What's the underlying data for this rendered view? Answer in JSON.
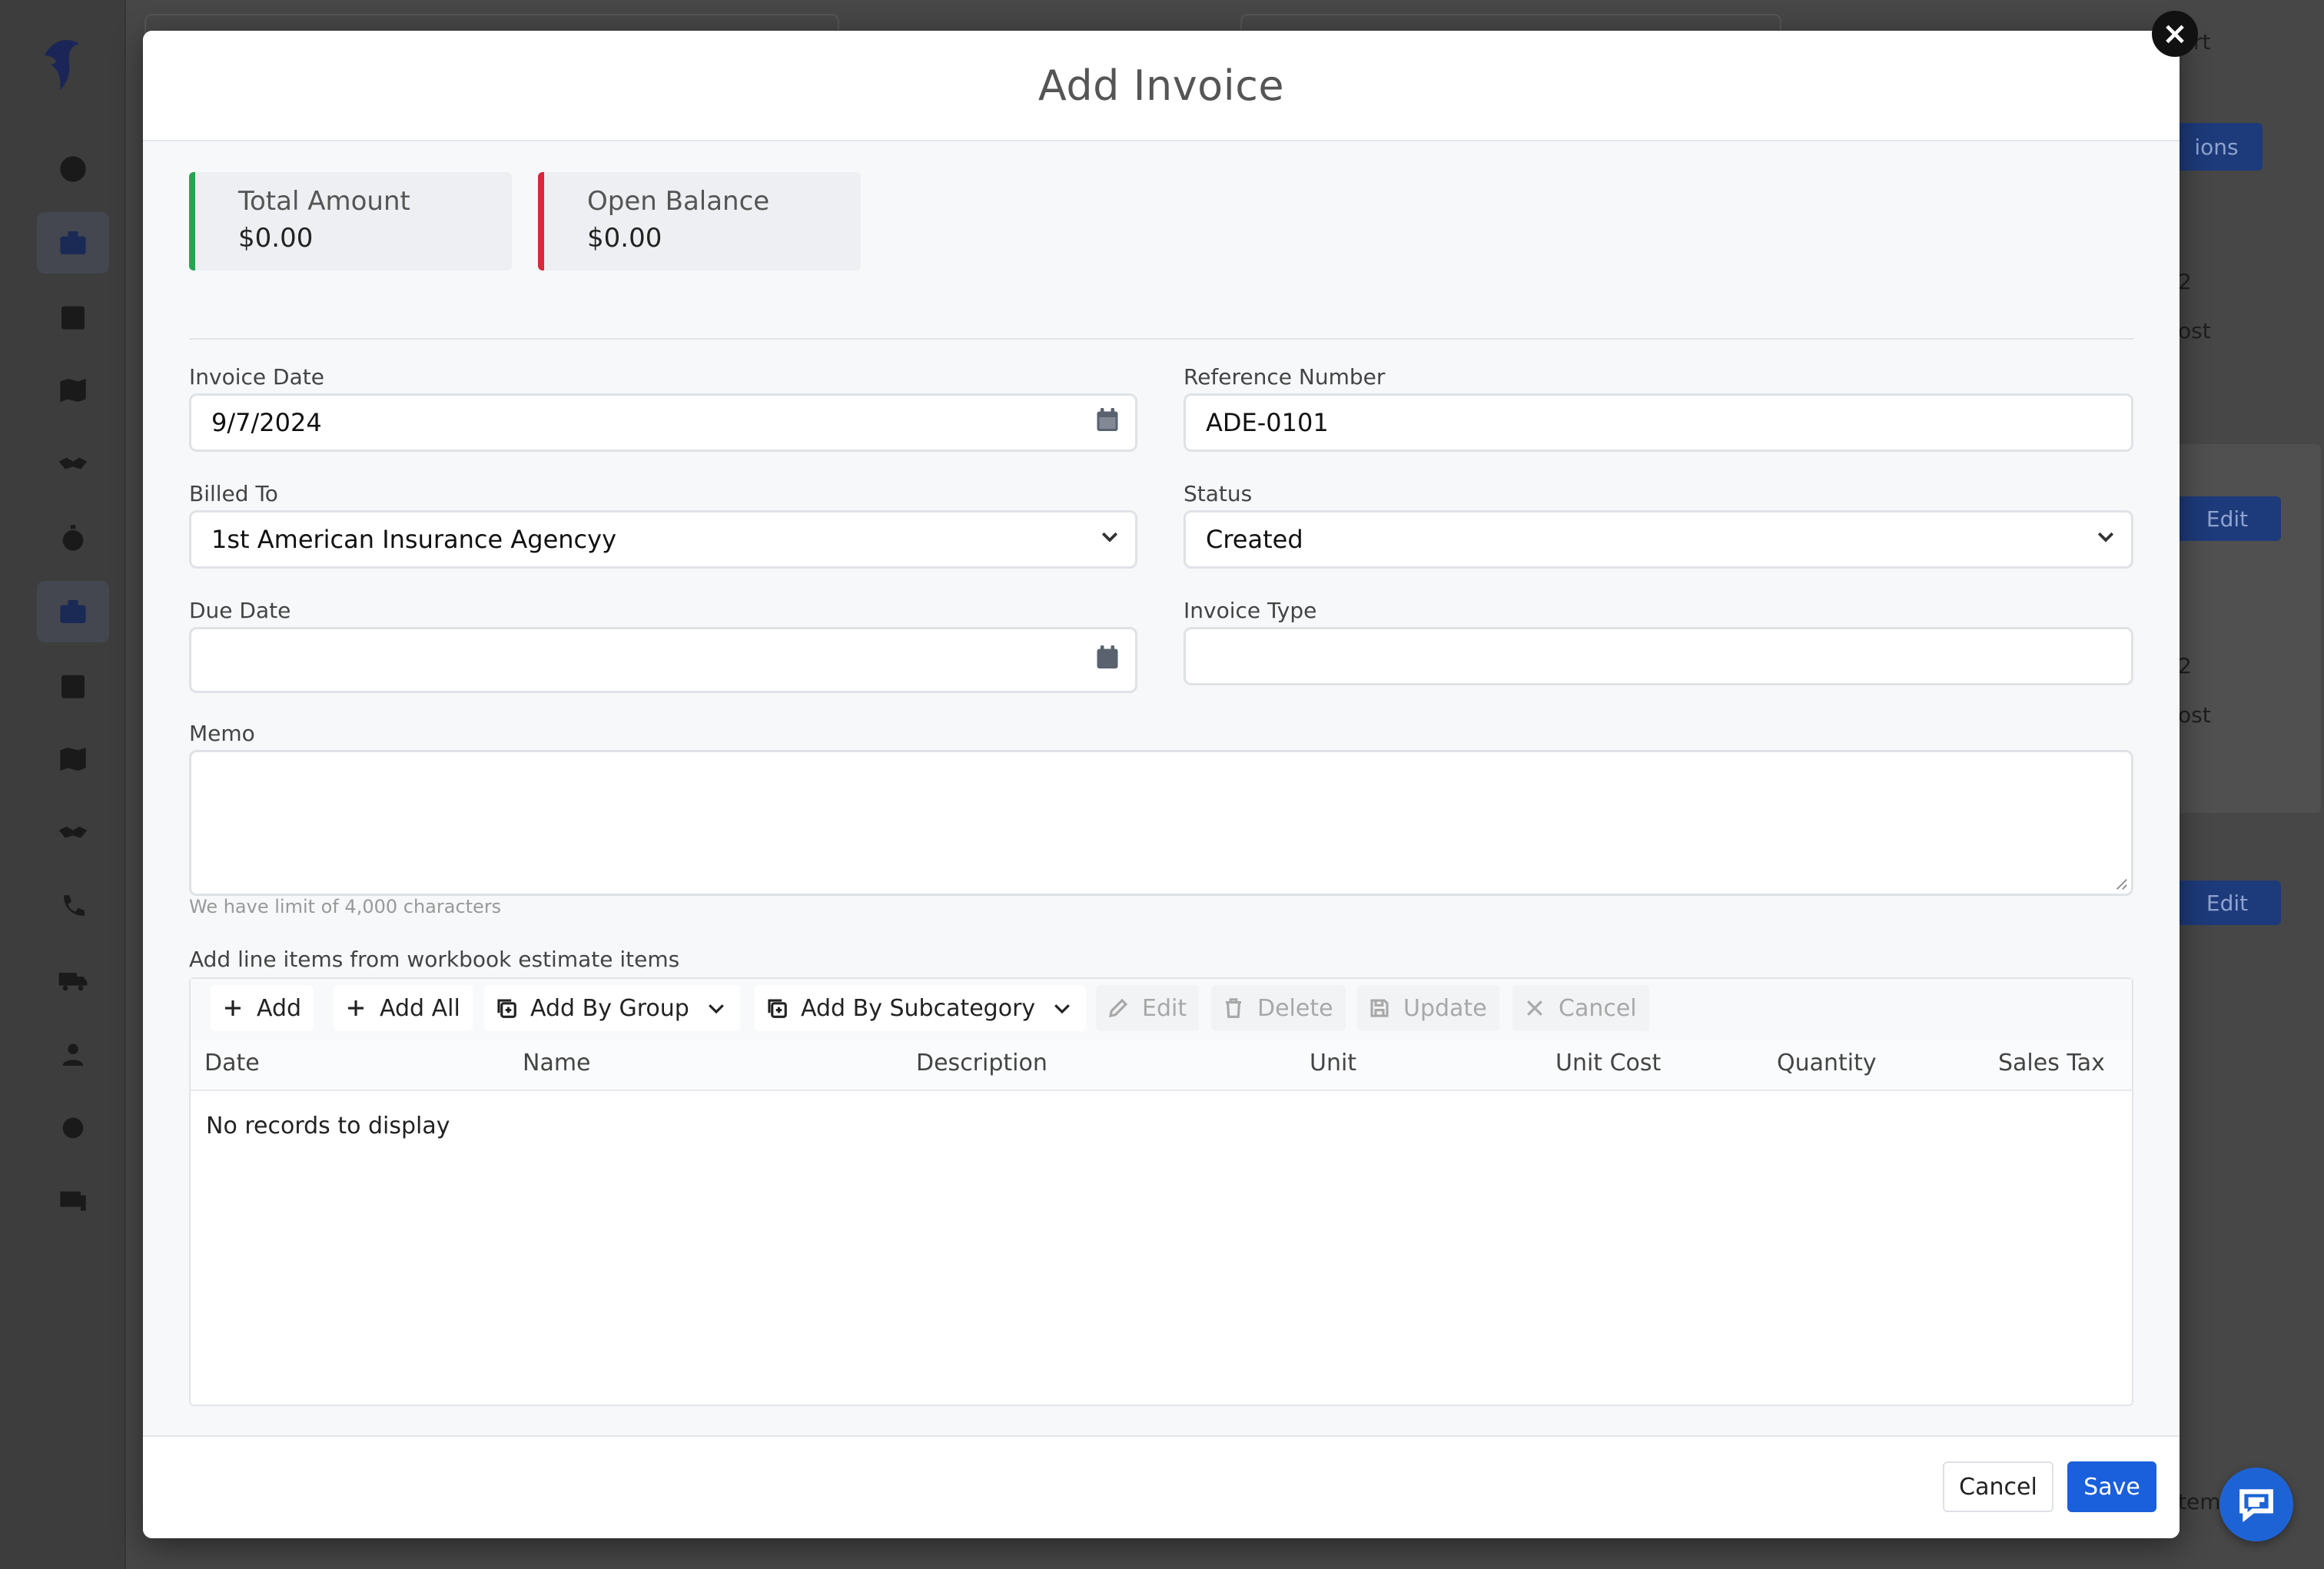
{
  "modal": {
    "title": "Add Invoice",
    "close_glyph": "×"
  },
  "summary": {
    "total_label": "Total Amount",
    "total_value": "$0.00",
    "balance_label": "Open Balance",
    "balance_value": "$0.00",
    "total_color": "#22a652",
    "balance_color": "#d8293b"
  },
  "form": {
    "invoice_date": {
      "label": "Invoice Date",
      "value": "9/7/2024"
    },
    "reference_number": {
      "label": "Reference Number",
      "value": "ADE-0101"
    },
    "billed_to": {
      "label": "Billed To",
      "value": "1st American Insurance Agencyy"
    },
    "status": {
      "label": "Status",
      "value": "Created"
    },
    "due_date": {
      "label": "Due Date",
      "value": ""
    },
    "invoice_type": {
      "label": "Invoice Type",
      "value": ""
    },
    "memo": {
      "label": "Memo",
      "value": "",
      "hint": "We have limit of 4,000 characters"
    }
  },
  "line_items": {
    "caption": "Add line items from workbook estimate items",
    "toolbar": {
      "add": "Add",
      "add_all": "Add All",
      "add_by_group": "Add By Group",
      "add_by_subcategory": "Add By Subcategory",
      "edit": "Edit",
      "delete": "Delete",
      "update": "Update",
      "cancel": "Cancel"
    },
    "columns": [
      "Date",
      "Name",
      "Description",
      "Unit",
      "Unit Cost",
      "Quantity",
      "Sales Tax"
    ],
    "empty_text": "No records to display"
  },
  "footer": {
    "cancel": "Cancel",
    "save": "Save"
  },
  "background": {
    "peek_texts": [
      "rt",
      "ions",
      "Edit",
      "Edit",
      "2",
      "ost",
      "2",
      "ost",
      "tem"
    ]
  },
  "colors": {
    "accent": "#1a5fdb",
    "sidebar_active": "#444750"
  },
  "icons": {
    "sidebar": [
      "dashboard-icon",
      "briefcase-icon",
      "calendar-icon",
      "map-icon",
      "handshake-icon",
      "stopwatch-icon",
      "briefcase-icon",
      "calendar-icon",
      "map-icon",
      "handshake-icon",
      "phone-icon",
      "truck-icon",
      "users-icon",
      "gear-icon",
      "devices-icon"
    ]
  }
}
